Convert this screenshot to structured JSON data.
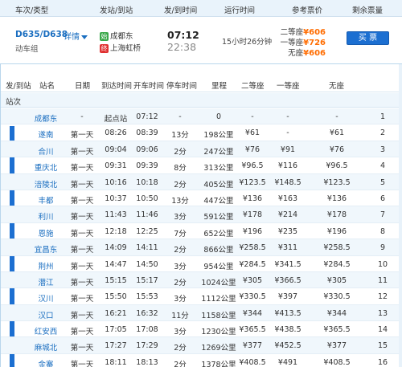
{
  "header": {
    "train_type_col": "车次/类型",
    "stations_col": "发站/到站",
    "time_col": "发/到时间",
    "duration_col": "运行时间",
    "price_col": "参考票价",
    "remaining_col": "剩余票量"
  },
  "train": {
    "number": "D635/D638",
    "detail_label": "详情",
    "type": "动车组",
    "from_badge": "始",
    "from_station": "成都东",
    "to_badge": "终",
    "to_station": "上海虹桥",
    "depart_time": "07:12",
    "arrive_time": "22:38",
    "duration": "15小时26分钟",
    "prices": [
      {
        "label": "二等座",
        "value": "¥606"
      },
      {
        "label": "一等座",
        "value": "¥726"
      },
      {
        "label": "无座",
        "value": "¥606"
      }
    ],
    "book_label": "买 票"
  },
  "stops_table": {
    "columns": {
      "from_to": "发/到站",
      "name": "站名",
      "day": "日期",
      "arrive": "到达时间",
      "depart": "开车时间",
      "stop": "停车时间",
      "distance": "里程",
      "second": "二等座",
      "first": "一等座",
      "standing": "无座"
    },
    "subhead": "站次",
    "side_label": "发",
    "rows": [
      {
        "name": "成都东",
        "day": "-",
        "arrive": "起点站",
        "depart": "07:12",
        "stop": "-",
        "distance": "0",
        "second": "-",
        "first": "-",
        "standing": "-",
        "idx": "1"
      },
      {
        "name": "遂南",
        "day": "第一天",
        "arrive": "08:26",
        "depart": "08:39",
        "stop": "13分",
        "distance": "198公里",
        "second": "¥61",
        "first": "-",
        "standing": "¥61",
        "idx": "2"
      },
      {
        "name": "合川",
        "day": "第一天",
        "arrive": "09:04",
        "depart": "09:06",
        "stop": "2分",
        "distance": "247公里",
        "second": "¥76",
        "first": "¥91",
        "standing": "¥76",
        "idx": "3"
      },
      {
        "name": "重庆北",
        "day": "第一天",
        "arrive": "09:31",
        "depart": "09:39",
        "stop": "8分",
        "distance": "313公里",
        "second": "¥96.5",
        "first": "¥116",
        "standing": "¥96.5",
        "idx": "4"
      },
      {
        "name": "涪陵北",
        "day": "第一天",
        "arrive": "10:16",
        "depart": "10:18",
        "stop": "2分",
        "distance": "405公里",
        "second": "¥123.5",
        "first": "¥148.5",
        "standing": "¥123.5",
        "idx": "5"
      },
      {
        "name": "丰都",
        "day": "第一天",
        "arrive": "10:37",
        "depart": "10:50",
        "stop": "13分",
        "distance": "447公里",
        "second": "¥136",
        "first": "¥163",
        "standing": "¥136",
        "idx": "6"
      },
      {
        "name": "利川",
        "day": "第一天",
        "arrive": "11:43",
        "depart": "11:46",
        "stop": "3分",
        "distance": "591公里",
        "second": "¥178",
        "first": "¥214",
        "standing": "¥178",
        "idx": "7"
      },
      {
        "name": "恩施",
        "day": "第一天",
        "arrive": "12:18",
        "depart": "12:25",
        "stop": "7分",
        "distance": "652公里",
        "second": "¥196",
        "first": "¥235",
        "standing": "¥196",
        "idx": "8"
      },
      {
        "name": "宜昌东",
        "day": "第一天",
        "arrive": "14:09",
        "depart": "14:11",
        "stop": "2分",
        "distance": "866公里",
        "second": "¥258.5",
        "first": "¥311",
        "standing": "¥258.5",
        "idx": "9"
      },
      {
        "name": "荆州",
        "day": "第一天",
        "arrive": "14:47",
        "depart": "14:50",
        "stop": "3分",
        "distance": "954公里",
        "second": "¥284.5",
        "first": "¥341.5",
        "standing": "¥284.5",
        "idx": "10"
      },
      {
        "name": "潜江",
        "day": "第一天",
        "arrive": "15:15",
        "depart": "15:17",
        "stop": "2分",
        "distance": "1024公里",
        "second": "¥305",
        "first": "¥366.5",
        "standing": "¥305",
        "idx": "11"
      },
      {
        "name": "汉川",
        "day": "第一天",
        "arrive": "15:50",
        "depart": "15:53",
        "stop": "3分",
        "distance": "1112公里",
        "second": "¥330.5",
        "first": "¥397",
        "standing": "¥330.5",
        "idx": "12"
      },
      {
        "name": "汉口",
        "day": "第一天",
        "arrive": "16:21",
        "depart": "16:32",
        "stop": "11分",
        "distance": "1158公里",
        "second": "¥344",
        "first": "¥413.5",
        "standing": "¥344",
        "idx": "13"
      },
      {
        "name": "红安西",
        "day": "第一天",
        "arrive": "17:05",
        "depart": "17:08",
        "stop": "3分",
        "distance": "1230公里",
        "second": "¥365.5",
        "first": "¥438.5",
        "standing": "¥365.5",
        "idx": "14"
      },
      {
        "name": "麻城北",
        "day": "第一天",
        "arrive": "17:27",
        "depart": "17:29",
        "stop": "2分",
        "distance": "1269公里",
        "second": "¥377",
        "first": "¥452.5",
        "standing": "¥377",
        "idx": "15"
      },
      {
        "name": "金寨",
        "day": "第一天",
        "arrive": "18:11",
        "depart": "18:13",
        "stop": "2分",
        "distance": "1378公里",
        "second": "¥408.5",
        "first": "¥491",
        "standing": "¥408.5",
        "idx": "16"
      }
    ]
  },
  "colors": {
    "accent": "#1c6fd1",
    "price": "#ff6c00",
    "header_bg": "#e9f3fb",
    "row_alt": "#f0f7fc"
  }
}
